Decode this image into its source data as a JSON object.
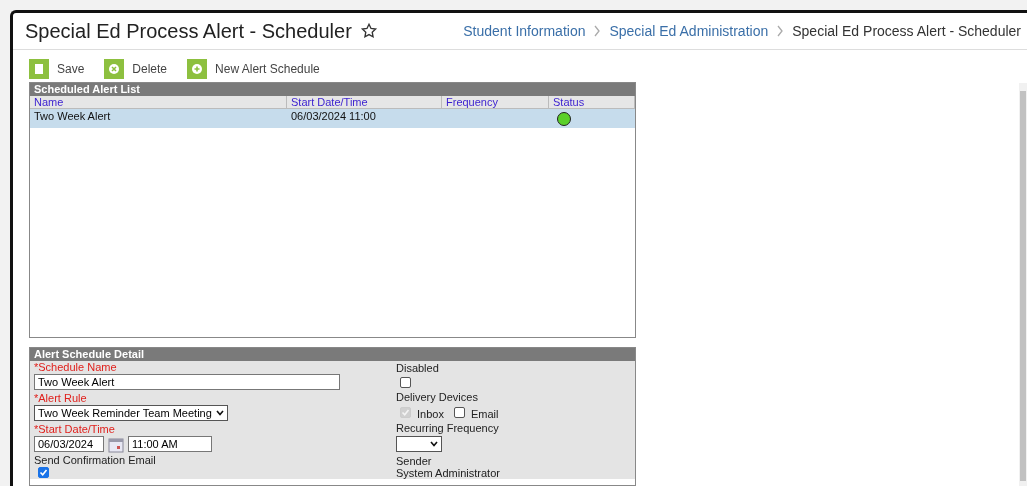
{
  "header": {
    "title": "Special Ed Process Alert - Scheduler",
    "breadcrumbs": [
      {
        "label": "Student Information",
        "link": true
      },
      {
        "label": "Special Ed Administration",
        "link": true
      },
      {
        "label": "Special Ed Process Alert - Scheduler",
        "link": false
      }
    ]
  },
  "toolbar": [
    {
      "kind": "save",
      "label": "Save"
    },
    {
      "kind": "delete",
      "label": "Delete"
    },
    {
      "kind": "new",
      "label": "New Alert Schedule"
    }
  ],
  "alert_list": {
    "title": "Scheduled Alert List",
    "columns": [
      "Name",
      "Start Date/Time",
      "Frequency",
      "Status"
    ],
    "rows": [
      {
        "name": "Two Week Alert",
        "start": "06/03/2024 11:00",
        "color": "#5bd02a",
        "selected": true
      }
    ]
  },
  "detail": {
    "title": "Alert Schedule Detail",
    "schedule_name": {
      "label": "*Schedule Name",
      "value": "Two Week Alert"
    },
    "alert_rule": {
      "label": "*Alert Rule",
      "value": "Two Week Reminder Team Meeting"
    },
    "start": {
      "label": "*Start Date/Time",
      "date": "06/03/2024",
      "time": "11:00 AM"
    },
    "confirmation": {
      "label": "Send Confirmation Email",
      "checked": true
    },
    "disabled": {
      "label": "Disabled",
      "checked": false
    },
    "delivery": {
      "label": "Delivery Devices",
      "options": [
        {
          "label": "Inbox",
          "checked": true,
          "disabled": true
        },
        {
          "label": "Email",
          "checked": false,
          "disabled": false
        }
      ]
    },
    "recurring": {
      "label": "Recurring Frequency"
    },
    "sender": {
      "label": "Sender",
      "value": "System Administrator"
    }
  }
}
